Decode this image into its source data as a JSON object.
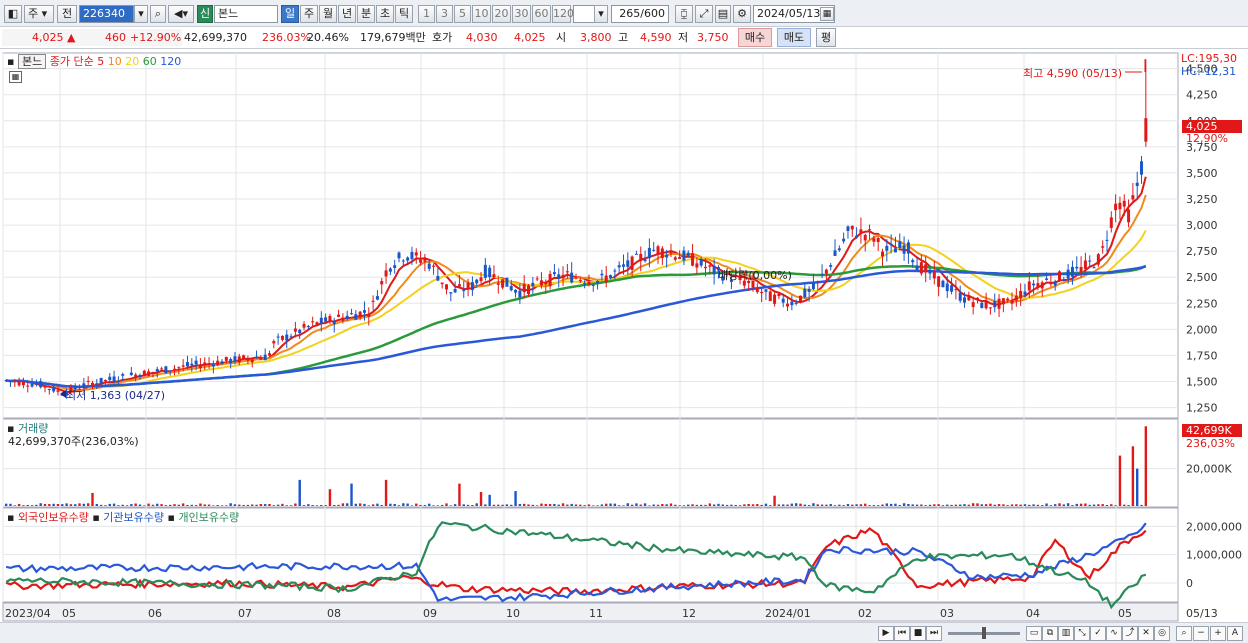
{
  "toolbar": {
    "market": "주",
    "all_label": "전",
    "code": "226340",
    "new_badge": "신",
    "stock_name": "본느",
    "periods": [
      "일",
      "주",
      "월",
      "년",
      "분",
      "초",
      "틱"
    ],
    "active_period": "일",
    "intervals": [
      "1",
      "3",
      "5",
      "10",
      "20",
      "30",
      "60",
      "120"
    ],
    "count": "265",
    "count_total": "/600",
    "date": "2024/05/13"
  },
  "quote": {
    "price": "4,025",
    "change": "460",
    "change_pct": "+12.90%",
    "volume": "42,699,370",
    "vol_ratio": "236.03%",
    "turnover": "20.46%",
    "amount": "179,679백만",
    "bid_label": "호가",
    "ask_price": "4,030",
    "bid_price": "4,025",
    "open_label": "시",
    "open": "3,800",
    "high_label": "고",
    "high": "4,590",
    "low_label": "저",
    "low": "3,750",
    "buy_label": "매수",
    "sell_label": "매도",
    "eval_label": "평"
  },
  "price_panel": {
    "series_name": "본느",
    "ma_label": "종가 단순",
    "ma_periods": [
      "5",
      "10",
      "20",
      "60",
      "120"
    ],
    "ma_colors": [
      "#e01818",
      "#f08a1c",
      "#f2d21a",
      "#2a9a3a",
      "#2a58d8"
    ],
    "lc": "LC:195,30",
    "hc": "HC:-12,31",
    "current_price_tag": "4,025",
    "current_pct_tag": "12,90%",
    "high_annot": "최고 4,590 (05/13)",
    "low_annot": "최저 1,363 (04/27)",
    "dividend_annot": "배당락(0,00%)",
    "y_labels": [
      "4,500",
      "4,250",
      "4,000",
      "3,750",
      "3,500",
      "3,250",
      "3,000",
      "2,750",
      "2,500",
      "2,250",
      "2,000",
      "1,750",
      "1,500",
      "1,250"
    ]
  },
  "volume_panel": {
    "title": "거래량",
    "summary": "42,699,370주(236,03%)",
    "tag_value": "42,699K",
    "tag_pct": "236,03%",
    "y_label": "20,000K"
  },
  "holdings_panel": {
    "series": [
      "외국인보유수량",
      "기관보유수량",
      "개인보유수량"
    ],
    "colors": [
      "#e01818",
      "#2a58d8",
      "#2a8a5a"
    ],
    "y_labels": [
      "2,000,000",
      "1,000,000",
      "0"
    ]
  },
  "x_axis": [
    "2023/04",
    "05",
    "06",
    "07",
    "08",
    "09",
    "10",
    "11",
    "12",
    "2024/01",
    "02",
    "03",
    "04",
    "05",
    "05/13"
  ]
}
